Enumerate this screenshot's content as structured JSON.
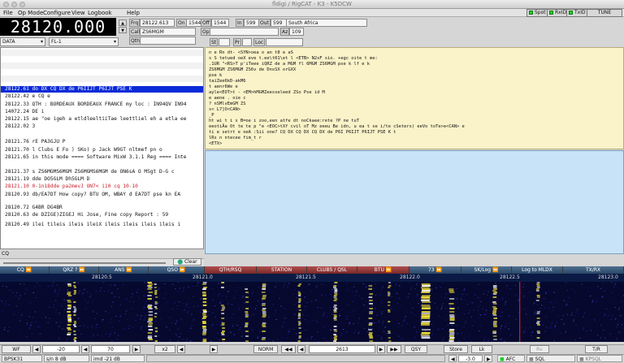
{
  "window": {
    "title": "fldigi / RigCAT - K3 - K5DCW"
  },
  "menus": [
    "File",
    "Op Mode",
    "Configure",
    "View",
    "Logbook",
    "Help"
  ],
  "indicators": [
    {
      "label": "Spot",
      "led": "#1fcf2a"
    },
    {
      "label": "RxID",
      "led": "#1fcf2a"
    },
    {
      "label": "TxID",
      "led": "#1fcf2a"
    },
    {
      "label": "TUNE",
      "led": ""
    }
  ],
  "rig": {
    "frequency": "28120.000",
    "mode": "DATA",
    "filter": "FL-1"
  },
  "qso": {
    "frq_label": "Frq",
    "frq": "28122.613",
    "on_label": "On",
    "on": "1544",
    "off_label": "Off",
    "off": "1544",
    "in_label": "In",
    "in": "599",
    "out_label": "Out",
    "out": "599",
    "country": "South Africa",
    "call_label": "Call",
    "call": "ZS6MGM",
    "op_label": "Op",
    "op": "",
    "az_label": "Az",
    "az": "109",
    "qth_label": "Qth",
    "qth": "",
    "st_label": "St",
    "st": "",
    "pr_label": "Pr",
    "pr": "",
    "loc_label": "Loc",
    "loc": ""
  },
  "rx_lines": [
    {
      "text": "28122.61 do DX CQ DX de P6IIJT P6IJT PSE K",
      "style": "sel"
    },
    {
      "text": "28122.42 e CQ   e",
      "style": ""
    },
    {
      "text": "28122.33 QTH : BORDEAUX BORDEAUX FRANCE my loc : IN94QV IN94",
      "style": ""
    },
    {
      "text": "14072.24 DE i",
      "style": ""
    },
    {
      "text": "28122.15 ae \"oe igeh a etldleeltiiTae leettliel eh a etla ee",
      "style": ""
    },
    {
      "text": "28122.02 3",
      "style": ""
    },
    {
      "text": "28121.76 rE PA3GJU P",
      "style": ""
    },
    {
      "text": "28121.70  l  Clubs E  Fo )  SKo) p   Jack W9GT nltmef pn   o",
      "style": ""
    },
    {
      "text": "28121.65 in this mode ==== Software MixW 3.1.1 Reg ==== Inte",
      "style": ""
    },
    {
      "text": "28121.37  s ZS6MGMS6MGM ZS6MGMS6MGM de   ON6sA O  MSgt D-G c",
      "style": ""
    },
    {
      "text": "28121.19 dde DO5GLM Dh5GLM D",
      "style": ""
    },
    {
      "text": "28121.10 0-1n18dde pa2mevJ  ON7< i10 cq 10-10",
      "style": "red"
    },
    {
      "text": "28120.93 db/EA7DT  How copy? BTU OM, WBAY d  EA7DT pse kn EA",
      "style": ""
    },
    {
      "text": "28120.72 G4BR DG4BR",
      "style": ""
    },
    {
      "text": "28120.63 de DZIGE)ZIGEJ   Hi Jose, Fine copy  Report    : 59",
      "style": ""
    },
    {
      "text": "28120.49  ilei tileis ileis ileiX  ileis ileis ileis ileis i",
      "style": ""
    }
  ],
  "info_lines": [
    "n  e Rn dt-  <SYN>oea o an t8 e aS",
    " s S tetued    oeX eve t.ee\\t01\\et      l   <ETB> N2sF  sio. +egc oite t me:",
    ".1UR   \"<RS>T   p'iTeee iQRZ de  a MGM fl 6MGM ZS6MGM pse k lf  e   k",
    "ZS6MGM ZS6MGM ZS6v de DnsSX   orGXX",
    "pse k",
    "taiZee6kD-akM6",
    " t aenr6We e",
    "ayle<EOT>t - <EM>hMGMZeesseleed ZSo Pse id M",
    " e aene . oie c",
    "? nSMlvEmGM ZS",
    "s< L7]O<CAN>",
    "_P",
    "         ht wi t i s B=oe i zoo,een atfe   dt noCkaee:rete ?P ne tuT",
    "eeotiÄa  Ot  te te p  \"e  <EOC>tXf cvil  oT Mz eeeu Be idn, u  ea   t se i/te cSeters) eeVo toTe>e<CAN> e",
    " ti e  setrt e neA :Sii one? CQ DX CQ DX CQ DX de P6I P6IJT P6IJT PSE K t",
    "lRs n ntecee fim_t r",
    "<ETX>"
  ],
  "cq_label": "CQ",
  "clear_label": "Clear",
  "macros": [
    {
      "label": "CQ ⏩",
      "color": "blue"
    },
    {
      "label": "QRZ ? ⏩",
      "color": "blue"
    },
    {
      "label": "ANS ⏩",
      "color": "blue"
    },
    {
      "label": "QSO ⏩",
      "color": "blue"
    },
    {
      "label": "QTH/RSQ",
      "color": "red"
    },
    {
      "label": "STATION",
      "color": "red"
    },
    {
      "label": "CLUBS / QSL",
      "color": "red"
    },
    {
      "label": "BTU ⏩",
      "color": "red"
    },
    {
      "label": "73 ⏩",
      "color": "blue"
    },
    {
      "label": "SK/Log ⏩",
      "color": "blue"
    },
    {
      "label": "Log to MLDX",
      "color": "blue"
    },
    {
      "label": "TX/RX",
      "color": "blue"
    }
  ],
  "scale_ticks": [
    "28120.5",
    "28121.0",
    "28121.5",
    "28122.0",
    "28122.5",
    "28123.0"
  ],
  "waterfall": {
    "background": "#06082e",
    "signal_color": "#f2e23a",
    "cursor_color": "#ff2020",
    "signals": [
      {
        "pos": 0.108,
        "width": 0.006,
        "intensity": 0.9
      },
      {
        "pos": 0.118,
        "width": 0.004,
        "intensity": 0.6
      },
      {
        "pos": 0.237,
        "width": 0.007,
        "intensity": 0.85
      },
      {
        "pos": 0.248,
        "width": 0.004,
        "intensity": 0.5
      },
      {
        "pos": 0.325,
        "width": 0.006,
        "intensity": 0.95
      },
      {
        "pos": 0.355,
        "width": 0.005,
        "intensity": 0.7
      },
      {
        "pos": 0.393,
        "width": 0.005,
        "intensity": 0.55
      },
      {
        "pos": 0.42,
        "width": 0.006,
        "intensity": 0.65
      },
      {
        "pos": 0.478,
        "width": 0.004,
        "intensity": 0.5
      },
      {
        "pos": 0.535,
        "width": 0.005,
        "intensity": 0.75
      },
      {
        "pos": 0.591,
        "width": 0.006,
        "intensity": 0.6
      },
      {
        "pos": 0.622,
        "width": 0.004,
        "intensity": 0.5
      },
      {
        "pos": 0.675,
        "width": 0.014,
        "intensity": 1.0
      },
      {
        "pos": 0.72,
        "width": 0.008,
        "intensity": 0.85
      },
      {
        "pos": 0.79,
        "width": 0.006,
        "intensity": 0.7
      },
      {
        "pos": 0.86,
        "width": 0.005,
        "intensity": 0.5
      }
    ],
    "cursor_pos": 0.833
  },
  "controls": {
    "wf_label": "WF",
    "lower": "-20",
    "range": "70",
    "zoom": "x2",
    "speed": "NORM",
    "audio_freq": "2613",
    "qsy_label": "QSY",
    "store_label": "Store",
    "lk_label": "Lk",
    "rv_label": "Rv",
    "tr_label": "T/R"
  },
  "status": {
    "mode": "BPSK31",
    "sn": "s/n  8 dB",
    "imd": "imd -21 dB",
    "squelch_val": "-3.0",
    "afc_label": "AFC",
    "sql_label": "SQL",
    "kpsql_label": "KPSQL"
  }
}
